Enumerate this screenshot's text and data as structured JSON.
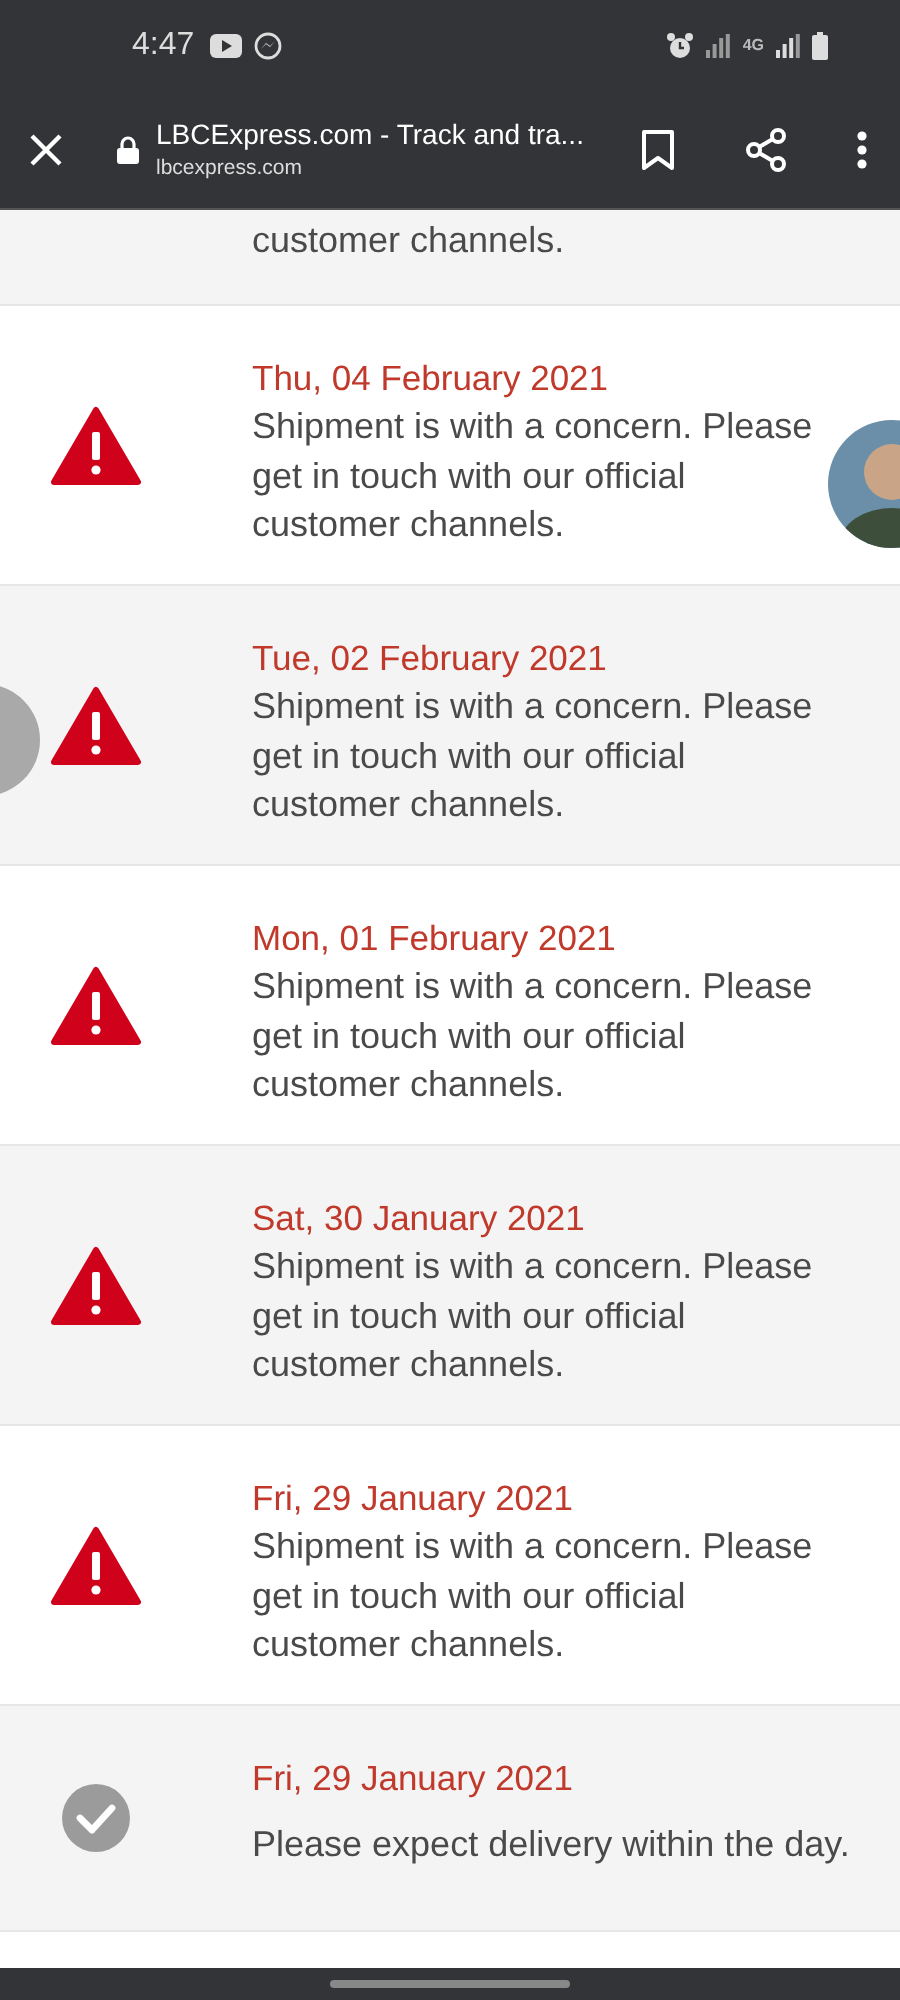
{
  "status_bar": {
    "time": "4:47",
    "network": "4G"
  },
  "toolbar": {
    "title": "LBCExpress.com - Track and tra...",
    "url": "lbcexpress.com"
  },
  "partial_entry": {
    "text": "customer channels."
  },
  "entries": [
    {
      "kind": "concern",
      "date": "Thu, 04 February 2021",
      "message": "Shipment is with a concern. Please get in touch with our official customer channels."
    },
    {
      "kind": "concern",
      "date": "Tue, 02 February 2021",
      "message": "Shipment is with a concern. Please get in touch with our official customer channels."
    },
    {
      "kind": "concern",
      "date": "Mon, 01 February 2021",
      "message": "Shipment is with a concern. Please get in touch with our official customer channels."
    },
    {
      "kind": "concern",
      "date": "Sat, 30 January 2021",
      "message": "Shipment is with a concern. Please get in touch with our official customer channels."
    },
    {
      "kind": "concern",
      "date": "Fri, 29 January 2021",
      "message": "Shipment is with a concern. Please get in touch with our official customer channels."
    },
    {
      "kind": "done",
      "date": "Fri, 29 January 2021",
      "message": "Please expect delivery within the day."
    }
  ]
}
